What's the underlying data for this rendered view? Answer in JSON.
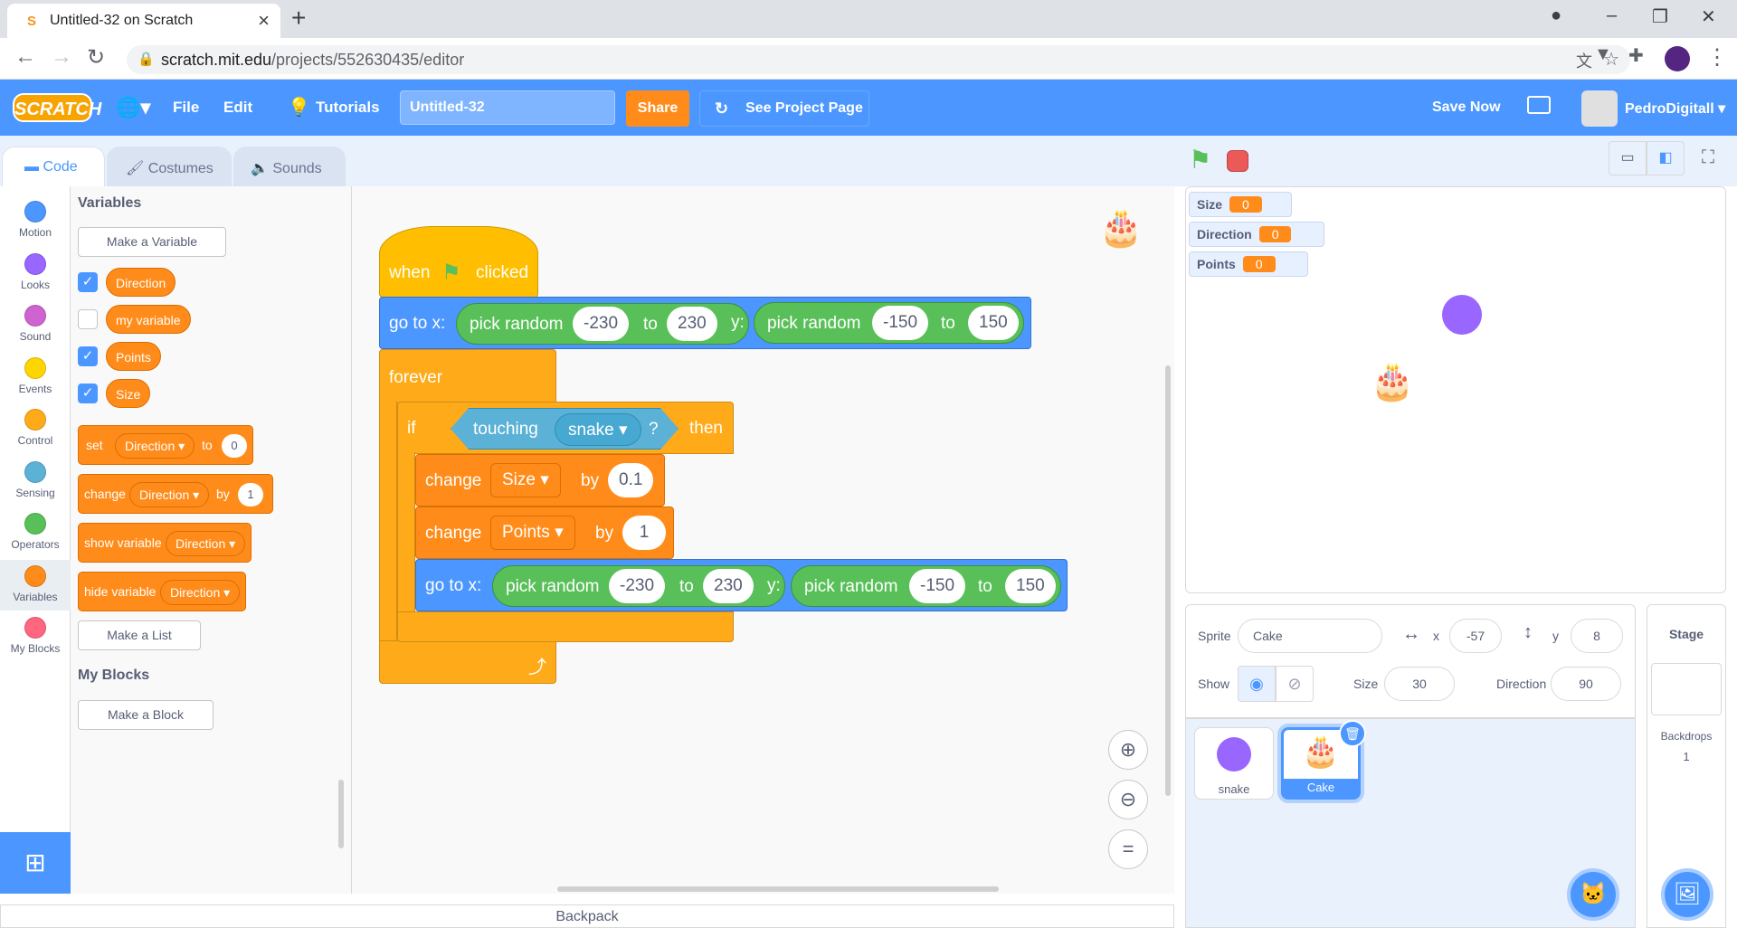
{
  "browser": {
    "tab_title": "Untitled-32 on Scratch",
    "url_host": "scratch.mit.edu",
    "url_path": "/projects/552630435/editor"
  },
  "menubar": {
    "logo": "SCRATCH",
    "file": "File",
    "edit": "Edit",
    "tutorials": "Tutorials",
    "project_title": "Untitled-32",
    "share": "Share",
    "see_project_page": "See Project Page",
    "save_now": "Save Now",
    "username": "PedroDigitall"
  },
  "tabs": {
    "code": "Code",
    "costumes": "Costumes",
    "sounds": "Sounds"
  },
  "categories": [
    {
      "label": "Motion",
      "color": "#4c97ff"
    },
    {
      "label": "Looks",
      "color": "#9966ff"
    },
    {
      "label": "Sound",
      "color": "#cf63cf"
    },
    {
      "label": "Events",
      "color": "#ffd500"
    },
    {
      "label": "Control",
      "color": "#ffab19"
    },
    {
      "label": "Sensing",
      "color": "#5cb1d6"
    },
    {
      "label": "Operators",
      "color": "#59c059"
    },
    {
      "label": "Variables",
      "color": "#ff8c1a"
    },
    {
      "label": "My Blocks",
      "color": "#ff6680"
    }
  ],
  "palette": {
    "variables_heading": "Variables",
    "make_variable": "Make a Variable",
    "variables": [
      {
        "name": "Direction",
        "checked": true
      },
      {
        "name": "my variable",
        "checked": false
      },
      {
        "name": "Points",
        "checked": true
      },
      {
        "name": "Size",
        "checked": true
      }
    ],
    "set_block": {
      "label": "set",
      "var": "Direction",
      "to": "to",
      "value": "0"
    },
    "change_block": {
      "label": "change",
      "var": "Direction",
      "by": "by",
      "value": "1"
    },
    "show_block": {
      "label": "show variable",
      "var": "Direction"
    },
    "hide_block": {
      "label": "hide variable",
      "var": "Direction"
    },
    "make_list": "Make a List",
    "myblocks_heading": "My Blocks",
    "make_block": "Make a Block"
  },
  "script": {
    "when": "when",
    "clicked": "clicked",
    "goto_label": "go to x:",
    "pick_random": "pick random",
    "to": "to",
    "y_label": "y:",
    "x_min": "-230",
    "x_max": "230",
    "y_min": "-150",
    "y_max": "150",
    "forever": "forever",
    "if": "if",
    "touching": "touching",
    "touching_target": "snake",
    "question": "?",
    "then": "then",
    "change": "change",
    "by": "by",
    "change1_var": "Size",
    "change1_val": "0.1",
    "change2_var": "Points",
    "change2_val": "1"
  },
  "monitors": [
    {
      "label": "Size",
      "value": "0"
    },
    {
      "label": "Direction",
      "value": "0"
    },
    {
      "label": "Points",
      "value": "0"
    }
  ],
  "sprite_info": {
    "sprite_label": "Sprite",
    "sprite_name": "Cake",
    "x_label": "x",
    "x": "-57",
    "y_label": "y",
    "y": "8",
    "show_label": "Show",
    "size_label": "Size",
    "size": "30",
    "direction_label": "Direction",
    "direction": "90"
  },
  "sprites": [
    {
      "name": "snake",
      "selected": false
    },
    {
      "name": "Cake",
      "selected": true
    }
  ],
  "stage_pane": {
    "title": "Stage",
    "backdrops_label": "Backdrops",
    "backdrops_count": "1"
  },
  "backpack": "Backpack"
}
